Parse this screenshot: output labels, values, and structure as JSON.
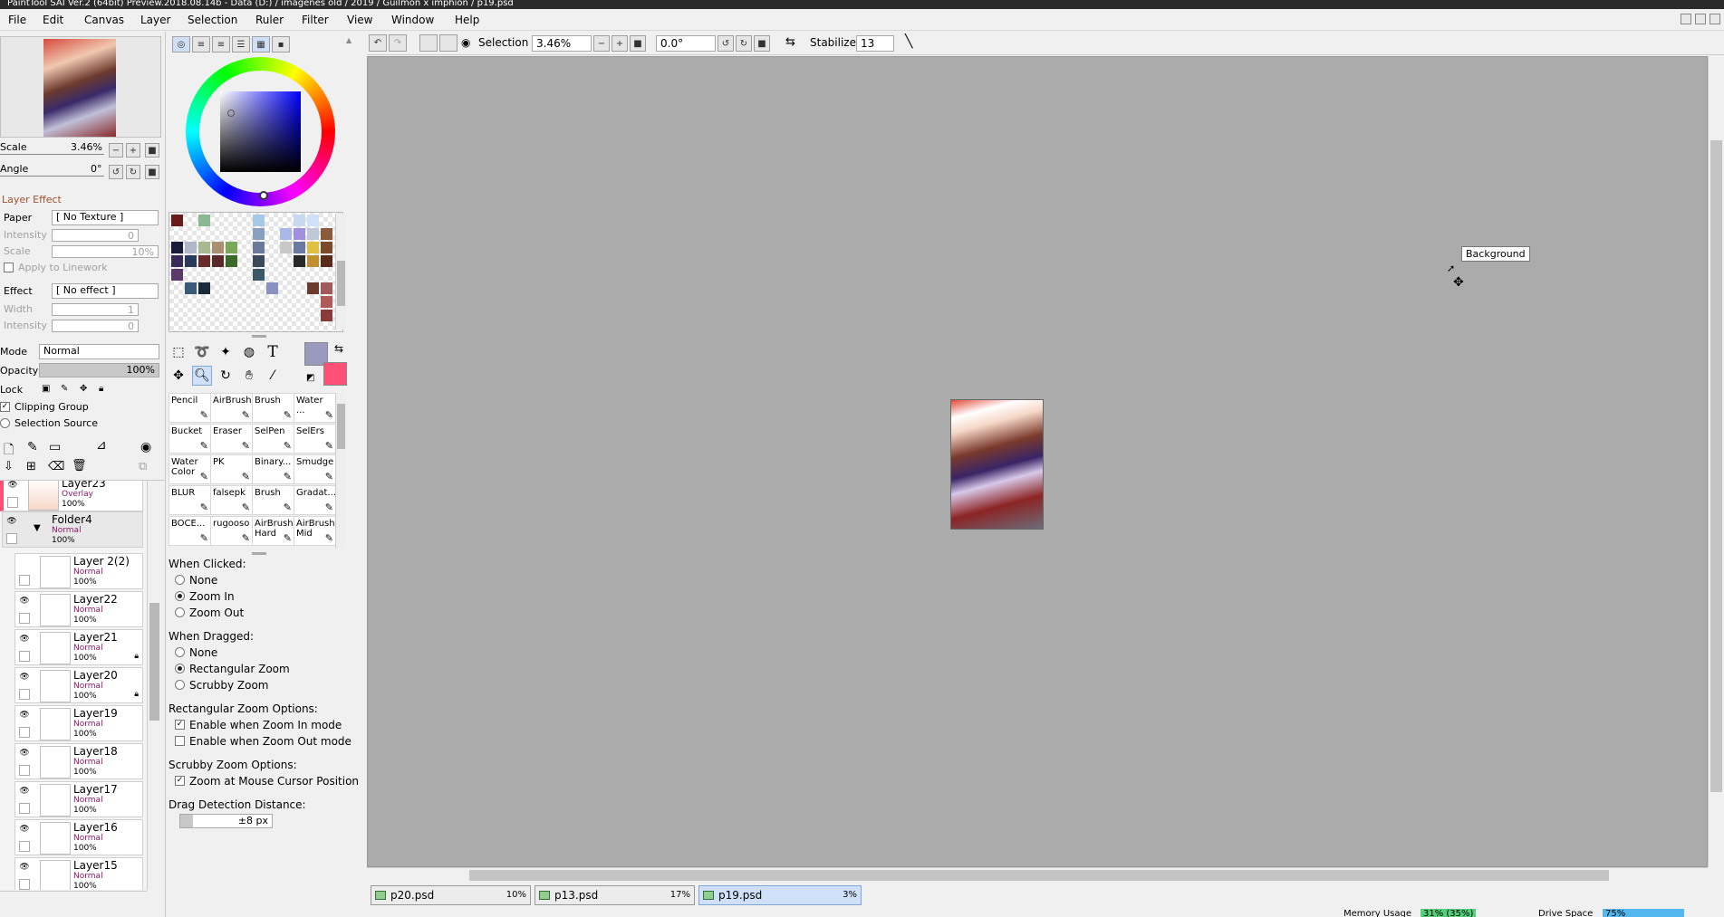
{
  "window": {
    "title": "PaintTool SAI Ver.2 (64bit) Preview.2018.08.14b - Data (D:) / imagenes old / 2019 / Guilmon x imphion / p19.psd"
  },
  "menu": [
    "File",
    "Edit",
    "Canvas",
    "Layer",
    "Selection",
    "Ruler",
    "Filter",
    "View",
    "Window",
    "Help"
  ],
  "navigator": {
    "scale_label": "Scale",
    "scale_value": "3.46%",
    "angle_label": "Angle",
    "angle_value": "0°"
  },
  "layer_effect": {
    "header": "Layer Effect",
    "paper_label": "Paper",
    "paper_value": "[ No Texture ]",
    "intensity_label": "Intensity",
    "intensity_value": "0",
    "scale_label": "Scale",
    "scale_value": "10%",
    "apply_linework": "Apply to Linework",
    "effect_label": "Effect",
    "effect_value": "[ No effect ]",
    "width_label": "Width",
    "width_value": "1",
    "intensity2_label": "Intensity",
    "intensity2_value": "0"
  },
  "layer_props": {
    "mode_label": "Mode",
    "mode_value": "Normal",
    "opacity_label": "Opacity",
    "opacity_value": "100%",
    "lock_label": "Lock",
    "clipping_group": "Clipping Group",
    "selection_source": "Selection Source"
  },
  "layers": [
    {
      "name": "Layer23",
      "mode": "Overlay",
      "opacity": "100%"
    },
    {
      "name": "Folder4",
      "mode": "Normal",
      "opacity": "100%"
    },
    {
      "name": "Layer 2(2)",
      "mode": "Normal",
      "opacity": "100%"
    },
    {
      "name": "Layer22",
      "mode": "Normal",
      "opacity": "100%"
    },
    {
      "name": "Layer21",
      "mode": "Normal",
      "opacity": "100%"
    },
    {
      "name": "Layer20",
      "mode": "Normal",
      "opacity": "100%"
    },
    {
      "name": "Layer19",
      "mode": "Normal",
      "opacity": "100%"
    },
    {
      "name": "Layer18",
      "mode": "Normal",
      "opacity": "100%"
    },
    {
      "name": "Layer17",
      "mode": "Normal",
      "opacity": "100%"
    },
    {
      "name": "Layer16",
      "mode": "Normal",
      "opacity": "100%"
    },
    {
      "name": "Layer15",
      "mode": "Normal",
      "opacity": "100%"
    }
  ],
  "brushes": [
    "Pencil",
    "AirBrush",
    "Brush",
    "Water ...",
    "Bucket",
    "Eraser",
    "SelPen",
    "SelErs",
    "Water Color",
    "PK",
    "Binary...",
    "Smudge",
    "BLUR",
    "falsepk",
    "Brush",
    "Gradat...",
    "BOCE...",
    "rugooso",
    "AirBrush Hard",
    "AirBrush Mid"
  ],
  "zoom_options": {
    "when_clicked": "When Clicked:",
    "clicked_options": [
      "None",
      "Zoom In",
      "Zoom Out"
    ],
    "clicked_selected": 1,
    "when_dragged": "When Dragged:",
    "dragged_options": [
      "None",
      "Rectangular Zoom",
      "Scrubby Zoom"
    ],
    "dragged_selected": 1,
    "rect_header": "Rectangular Zoom Options:",
    "rect_enable_in": "Enable when Zoom In mode",
    "rect_enable_out": "Enable when Zoom Out mode",
    "scrubby_header": "Scrubby Zoom Options:",
    "scrubby_mouse": "Zoom at Mouse Cursor Position",
    "drag_header": "Drag Detection Distance:",
    "drag_value": "±8 px"
  },
  "toolbar": {
    "selection_label": "Selection",
    "zoom_value": "3.46%",
    "angle_value": "0.0°",
    "stabilizer_label": "Stabilizer",
    "stabilizer_value": "13"
  },
  "canvas": {
    "tooltip": "Background"
  },
  "tabs": [
    {
      "name": "p20.psd",
      "pct": "10%"
    },
    {
      "name": "p13.psd",
      "pct": "17%"
    },
    {
      "name": "p19.psd",
      "pct": "3%"
    }
  ],
  "status": {
    "memory_label": "Memory Usage",
    "memory_value": "31% (35%)",
    "drive_label": "Drive Space",
    "drive_value": "75%"
  },
  "colors": {
    "primary": "#9a9ac0",
    "secondary": "#ff5078",
    "canvas_bg": "#ababab"
  }
}
